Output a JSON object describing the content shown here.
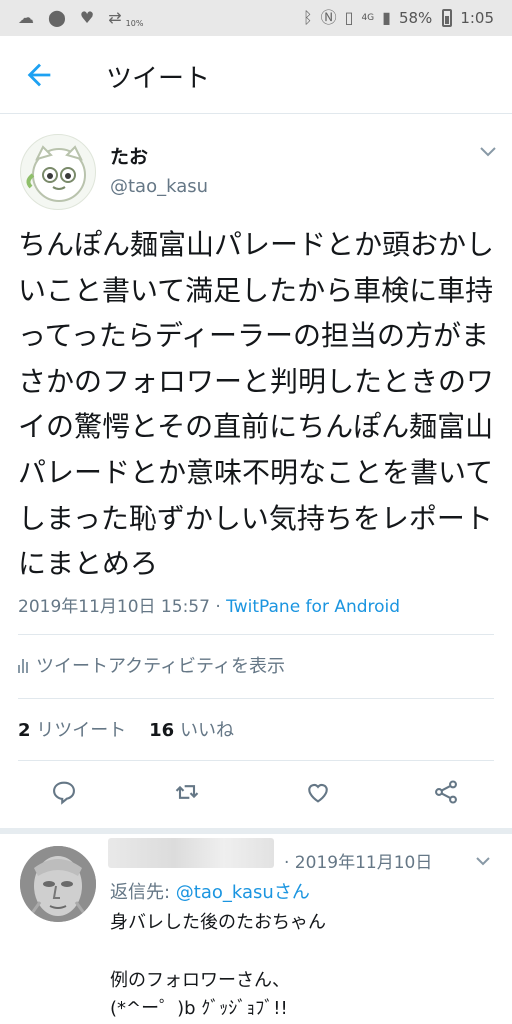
{
  "statusbar": {
    "data_speed": "10%",
    "network": "4G",
    "battery": "58%",
    "time": "1:05"
  },
  "header": {
    "title": "ツイート"
  },
  "tweet": {
    "author_name": "たお",
    "author_handle": "@tao_kasu",
    "text": "ちんぽん麺富山パレードとか頭おかしいこと書いて満足したから車検に車持ってったらディーラーの担当の方がまさかのフォロワーと判明したときのワイの驚愕とその直前にちんぽん麺富山パレードとか意味不明なことを書いてしまった恥ずかしい気持ちをレポートにまとめろ",
    "timestamp": "2019年11月10日 15:57",
    "separator": "·",
    "via": "TwitPane for Android",
    "activity_label": "ツイートアクティビティを表示",
    "retweet_count": "2",
    "retweet_label": "リツイート",
    "like_count": "16",
    "like_label": "いいね"
  },
  "icons": {
    "back": "arrow-left-icon",
    "reply": "comment-icon",
    "retweet": "retweet-icon",
    "like": "heart-icon",
    "share": "share-icon"
  },
  "reply": {
    "date": "· 2019年11月10日",
    "reply_to_prefix": "返信先: ",
    "reply_to_handle": "@tao_kasuさん",
    "line1": "身バレした後のたおちゃん",
    "line2": "例のフォロワーさん、",
    "line3": "(*^ー゜)b ｸﾞｯｼﾞｮﾌﾞ!!"
  },
  "colors": {
    "accent": "#1da1f2",
    "link": "#1b95e0",
    "secondary_text": "#657786",
    "divider": "#e1e8ed"
  }
}
